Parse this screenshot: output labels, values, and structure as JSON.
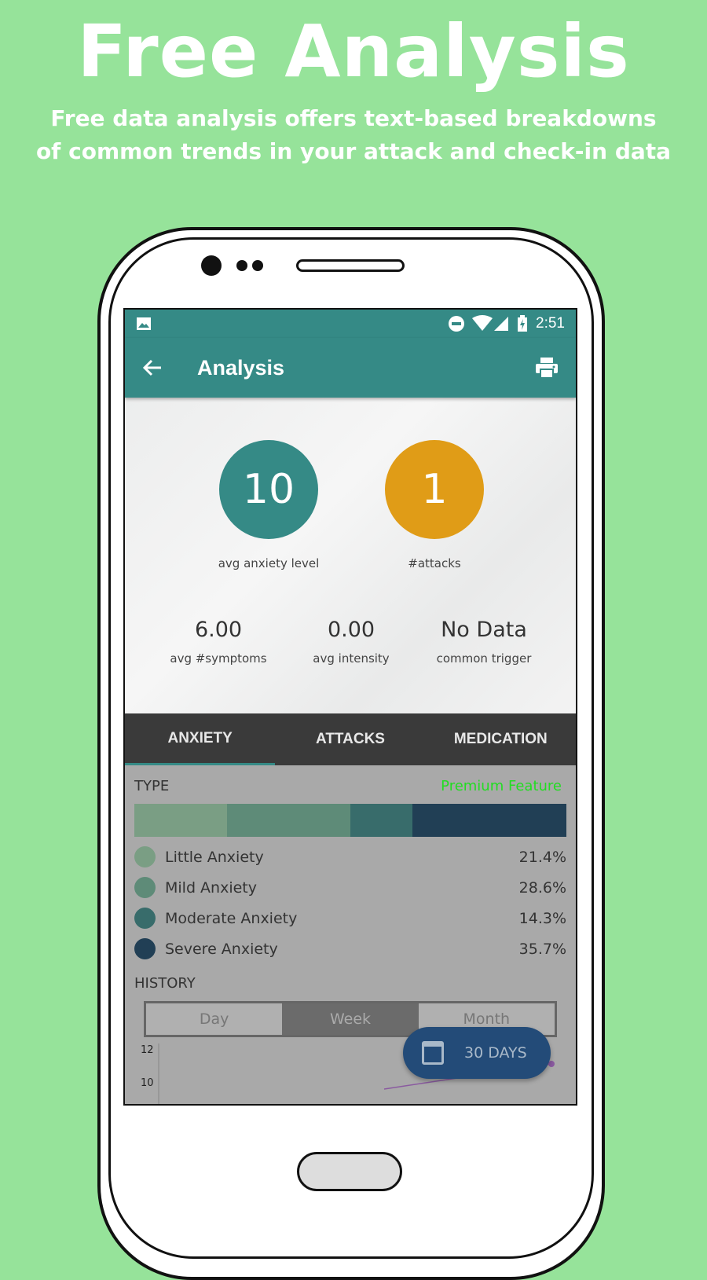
{
  "promo": {
    "title": "Free Analysis",
    "subtitle_line1": "Free data analysis offers text-based breakdowns",
    "subtitle_line2": "of common trends in your attack and check-in data"
  },
  "status_bar": {
    "time": "2:51",
    "icons": [
      "image-icon",
      "dnd-icon",
      "wifi-icon",
      "signal-icon",
      "battery-charging-icon"
    ]
  },
  "app_bar": {
    "title": "Analysis",
    "back_icon": "arrow-left-icon",
    "action_icon": "print-icon"
  },
  "summary": {
    "circles": [
      {
        "value": "10",
        "label": "avg anxiety level",
        "color": "#358a86"
      },
      {
        "value": "1",
        "label": "#attacks",
        "color": "#e09c17"
      }
    ],
    "stats": [
      {
        "value": "6.00",
        "label": "avg #symptoms"
      },
      {
        "value": "0.00",
        "label": "avg intensity"
      },
      {
        "value": "No Data",
        "label": "common trigger"
      }
    ]
  },
  "tabs": [
    {
      "label": "ANXIETY",
      "active": true
    },
    {
      "label": "ATTACKS",
      "active": false
    },
    {
      "label": "MEDICATION",
      "active": false
    }
  ],
  "type_section": {
    "title": "TYPE",
    "premium_label": "Premium Feature",
    "items": [
      {
        "name": "Little Anxiety",
        "percent": "21.4%",
        "value": 21.4,
        "color": "#7a9e84"
      },
      {
        "name": "Mild Anxiety",
        "percent": "28.6%",
        "value": 28.6,
        "color": "#5e8b78"
      },
      {
        "name": "Moderate Anxiety",
        "percent": "14.3%",
        "value": 14.3,
        "color": "#386c6b"
      },
      {
        "name": "Severe Anxiety",
        "percent": "35.7%",
        "value": 35.7,
        "color": "#213f55"
      }
    ]
  },
  "history": {
    "title": "HISTORY",
    "segments": [
      {
        "label": "Day",
        "active": false
      },
      {
        "label": "Week",
        "active": true
      },
      {
        "label": "Month",
        "active": false
      }
    ],
    "y_ticks": [
      "12",
      "10"
    ],
    "line_color": "#8a5aa0"
  },
  "fab": {
    "label": "30 DAYS",
    "icon": "calendar-icon"
  }
}
